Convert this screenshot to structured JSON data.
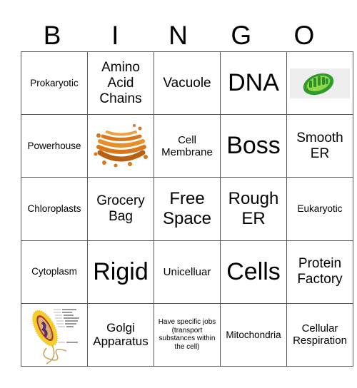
{
  "header": [
    "B",
    "I",
    "N",
    "G",
    "O"
  ],
  "cells": [
    [
      {
        "text": "Prokaryotic"
      },
      {
        "text": "Amino Acid Chains"
      },
      {
        "text": "Vacuole"
      },
      {
        "text": "DNA"
      },
      {
        "image": "chloroplast-image"
      }
    ],
    [
      {
        "text": "Powerhouse"
      },
      {
        "image": "golgi-apparatus-image"
      },
      {
        "text": "Cell Membrane"
      },
      {
        "text": "Boss"
      },
      {
        "text": "Smooth ER"
      }
    ],
    [
      {
        "text": "Chloroplasts"
      },
      {
        "text": "Grocery Bag"
      },
      {
        "text": "Free Space"
      },
      {
        "text": "Rough ER"
      },
      {
        "text": "Eukaryotic"
      }
    ],
    [
      {
        "text": "Cytoplasm"
      },
      {
        "text": "Rigid"
      },
      {
        "text": "Unicelluar"
      },
      {
        "text": "Cells"
      },
      {
        "text": "Protein Factory"
      }
    ],
    [
      {
        "image": "bacterium-diagram-image"
      },
      {
        "text": "Golgi Apparatus"
      },
      {
        "text": "Have specific jobs (transport substances within the cell)"
      },
      {
        "text": "Mitochondria"
      },
      {
        "text": "Cellular Respiration"
      }
    ]
  ],
  "colors": {
    "grid_line": "#555555",
    "chloroplast_green": "#3fae3a",
    "golgi_orange": "#d9781a",
    "bacterium_yellow": "#f2d027"
  }
}
